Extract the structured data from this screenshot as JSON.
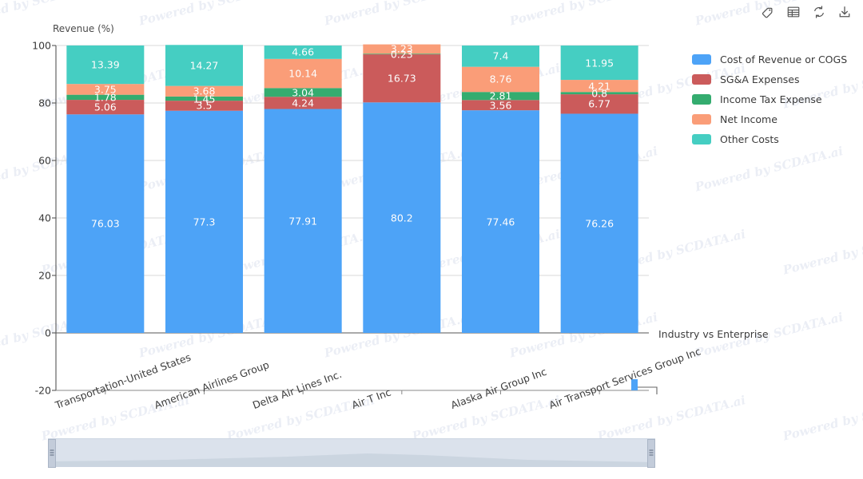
{
  "toolbar": {
    "icons": [
      {
        "name": "tag-icon",
        "label": "Tag"
      },
      {
        "name": "table-icon",
        "label": "Table"
      },
      {
        "name": "refresh-icon",
        "label": "Refresh"
      },
      {
        "name": "download-icon",
        "label": "Download"
      }
    ]
  },
  "watermark": {
    "text": "Powered by SCDATA.ai"
  },
  "axis_note": "Industry vs Enterprise",
  "legend": {
    "position": "right",
    "items": [
      {
        "label": "Cost of Revenue or COGS",
        "color": "#4da3f7"
      },
      {
        "label": "SG&A Expenses",
        "color": "#cb5b5b"
      },
      {
        "label": "Income Tax Expense",
        "color": "#34ac6f"
      },
      {
        "label": "Net Income",
        "color": "#fa9d78"
      },
      {
        "label": "Other Costs",
        "color": "#45cec2"
      }
    ]
  },
  "chart_data": {
    "type": "bar",
    "stacked": true,
    "title": "",
    "xlabel": "",
    "ylabel": "Revenue (%)",
    "ylim": [
      -20,
      100
    ],
    "yticks": [
      -20,
      0,
      20,
      40,
      60,
      80,
      100
    ],
    "grid": true,
    "categories": [
      "Transportation-United States",
      "American Airlines Group",
      "Delta Air Lines Inc.",
      "Air T Inc",
      "Alaska Air Group Inc",
      "Air Transport Services Group Inc"
    ],
    "series": [
      {
        "name": "Cost of Revenue or COGS",
        "color": "#4da3f7",
        "values": [
          76.03,
          77.3,
          77.91,
          80.2,
          77.46,
          76.26
        ]
      },
      {
        "name": "SG&A Expenses",
        "color": "#cb5b5b",
        "values": [
          5.06,
          3.5,
          4.24,
          16.73,
          3.56,
          6.77
        ]
      },
      {
        "name": "Income Tax Expense",
        "color": "#34ac6f",
        "values": [
          1.78,
          1.45,
          3.04,
          0.23,
          2.81,
          0.8
        ]
      },
      {
        "name": "Net Income",
        "color": "#fa9d78",
        "values": [
          3.75,
          3.68,
          10.14,
          3.23,
          8.76,
          4.21
        ]
      },
      {
        "name": "Other Costs",
        "color": "#45cec2",
        "values": [
          13.39,
          14.27,
          4.66,
          0,
          7.4,
          11.95
        ]
      }
    ]
  },
  "range_slider": {
    "left_handle": "range-start-handle",
    "right_handle": "range-end-handle"
  }
}
